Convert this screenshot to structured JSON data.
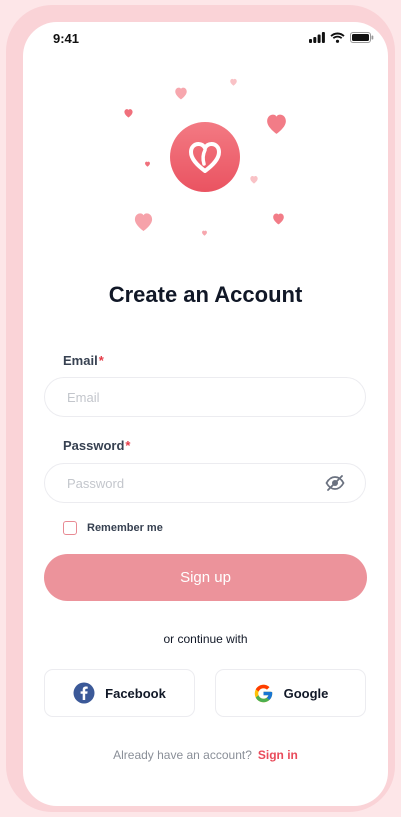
{
  "status_bar": {
    "time": "9:41"
  },
  "colors": {
    "accent": "#e94b5b",
    "primary_button": "#ec939b",
    "frame": "#fad3d7",
    "background": "#fde6e8"
  },
  "header": {
    "title": "Create an Account"
  },
  "form": {
    "email": {
      "label": "Email",
      "required_mark": "*",
      "placeholder": "Email",
      "value": ""
    },
    "password": {
      "label": "Password",
      "required_mark": "*",
      "placeholder": "Password",
      "value": ""
    },
    "remember_me": {
      "label": "Remember me",
      "checked": false
    },
    "submit_label": "Sign up"
  },
  "divider_text": "or continue with",
  "social": [
    {
      "label": "Facebook",
      "icon": "facebook-icon"
    },
    {
      "label": "Google",
      "icon": "google-icon"
    }
  ],
  "footer": {
    "prompt": "Already have an account?",
    "link": "Sign in"
  }
}
